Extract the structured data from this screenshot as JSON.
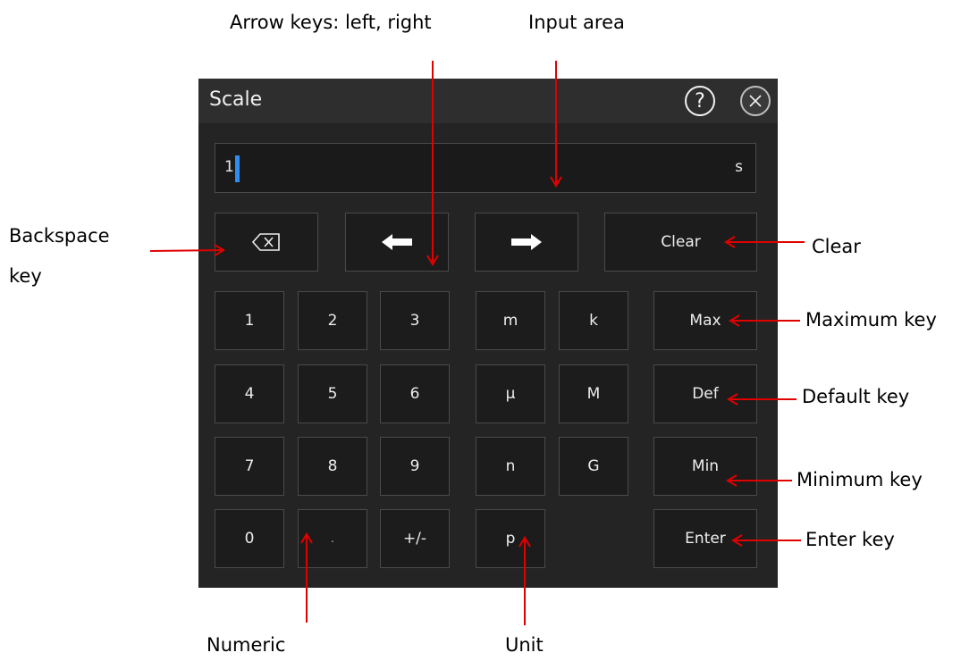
{
  "dialog": {
    "title": "Scale",
    "help_label": "?",
    "input": {
      "value": "1",
      "unit": "s"
    },
    "controls": {
      "clear": "Clear",
      "max": "Max",
      "def": "Def",
      "min": "Min",
      "enter": "Enter"
    },
    "digits": [
      "1",
      "2",
      "3",
      "4",
      "5",
      "6",
      "7",
      "8",
      "9",
      "0",
      ".",
      "+/-"
    ],
    "units": [
      "m",
      "k",
      "μ",
      "M",
      "n",
      "G",
      "p"
    ]
  },
  "annotations": {
    "arrow_keys": "Arrow keys: left, right",
    "input_area": "Input area",
    "backspace_line1": "Backspace",
    "backspace_line2": "key",
    "clear": "Clear",
    "maximum": "Maximum key",
    "default": "Default key",
    "minimum": "Minimum key",
    "enter": "Enter key",
    "numeric": "Numeric",
    "unit": "Unit"
  },
  "colors": {
    "accent_caret": "#2f8cf0",
    "annotation_arrow": "#e00000",
    "dialog_bg": "#242424"
  }
}
